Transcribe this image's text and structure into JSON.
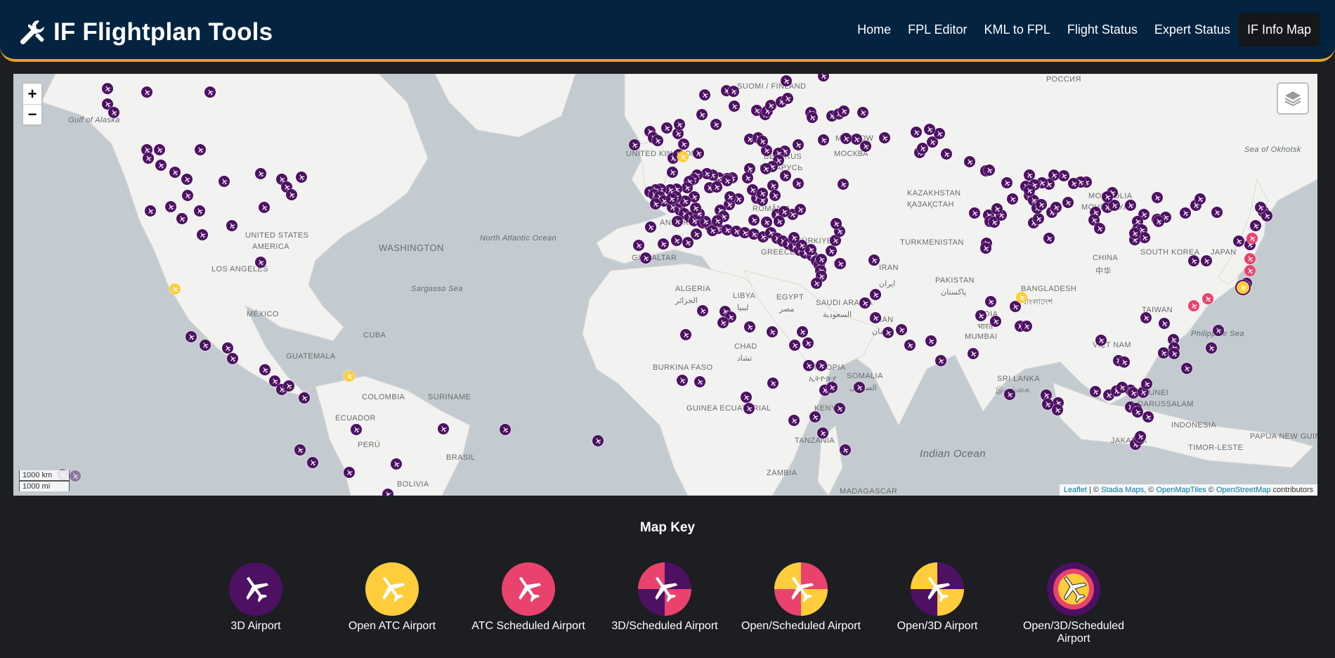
{
  "app": {
    "title": "IF Flightplan Tools",
    "accent_color": "#e6a21f",
    "navbar_color": "#032340",
    "brand_icon": "tools-icon"
  },
  "nav": {
    "items": [
      {
        "label": "Home",
        "active": false
      },
      {
        "label": "FPL Editor",
        "active": false
      },
      {
        "label": "KML to FPL",
        "active": false
      },
      {
        "label": "Flight Status",
        "active": false
      },
      {
        "label": "Expert Status",
        "active": false
      },
      {
        "label": "IF Info Map",
        "active": true
      }
    ]
  },
  "map": {
    "zoom_in": "+",
    "zoom_out": "−",
    "layers_icon": "layers-icon",
    "scale_km": "1000 km",
    "scale_mi": "1000 mi",
    "attribution": {
      "leaflet": "Leaflet",
      "sep1": " | © ",
      "stadia": "Stadia Maps",
      "sep2": ", © ",
      "omt": "OpenMapTiles",
      "sep3": " © ",
      "osm": "OpenStreetMap",
      "tail": " contributors"
    },
    "labels": {
      "russia": "РОССИЯ",
      "finland": "SUOMI / FINLAND",
      "moscow": "MOSCOW",
      "moskva": "МОСКВА",
      "belarus1": "BELARUS",
      "belarus2": "БЕЛАРУСЬ",
      "kazakhstan1": "KAZAKHSTAN",
      "kazakhstan2": "ҚАЗАҚСТАН",
      "mongolia1": "MONGOLIA",
      "mongolia2": "МОНГОЛ УЛС",
      "sea_okhotsk": "Sea of Okhotsk",
      "gulf_alaska": "Gulf of Alaska",
      "united_kingdom": "UNITED KINGDOM",
      "romania": "ROMÂNIA",
      "united_states": "UNITED STATES",
      "america": "AMERICA",
      "washington": "WASHINGTON",
      "los_angeles": "LOS ANGELES",
      "north_atlantic": "North Atlantic Ocean",
      "sargasso": "Sargasso Sea",
      "andorra": "ANDORRA",
      "gibraltar": "GIBRALTAR",
      "algeria1": "ALGERIA",
      "algeria2": "الجزائر",
      "libya1": "LIBYA",
      "libya2": "ليبيا",
      "egypt1": "EGYPT",
      "egypt2": "مصر",
      "saudi1": "SAUDI ARABIA",
      "saudi2": "السعودية",
      "turkmenistan": "TURKMENISTAN",
      "turkiye": "TÜRKIYE",
      "greece": "GREECE",
      "iran1": "IRAN",
      "iran2": "ایران",
      "pakistan1": "PAKISTAN",
      "pakistan2": "پاکستان",
      "india1": "INDIA",
      "india2": "भारत",
      "bangladesh1": "BANGLADESH",
      "bangladesh2": "বাংলাদেশ",
      "china1": "CHINA",
      "china2": "中华",
      "south_korea": "SOUTH KOREA",
      "japan": "JAPAN",
      "taiwan": "TAIWAN",
      "philippine_sea": "Philippine Sea",
      "oman1": "OMAN",
      "oman2": "عمان",
      "mumbai": "MUMBAI",
      "sri_lanka1": "SRI LANKA",
      "sri_lanka2": "இலங்கை",
      "viet_nam": "VIỆT NAM",
      "mexico": "MÉXICO",
      "guatemala": "GUATEMALA",
      "colombia": "COLOMBIA",
      "suriname": "SURINAME",
      "ecuador": "ECUADOR",
      "peru": "PERÚ",
      "brasil": "BRASIL",
      "bolivia": "BOLIVIA",
      "cuba": "CUBA",
      "chad1": "CHAD",
      "chad2": "تشاد",
      "burkina": "BURKINA FASO",
      "guinea": "GUINEA ECUATORIAL",
      "ethiopia1": "ETHIOPIA",
      "ethiopia2": "ኢትዮጵያ",
      "somalia1": "SOMALIA",
      "somalia2": "الصومال",
      "kenya": "KENYA",
      "tanzania": "TANZANIA",
      "zambia": "ZAMBIA",
      "madagascar": "MADAGASCAR",
      "indian_ocean": "Indian Ocean",
      "indonesia": "INDONESIA",
      "papua": "PAPUA NEW GUINEA",
      "timor": "TIMOR-LESTE",
      "jakarta": "JAKARTA",
      "brunei": "BRUNEI",
      "darussalam": "DARUSSALAM",
      "mongolia_c": "MONGOLIA"
    },
    "colors": {
      "water": "#c3cbd0",
      "land": "#f2f2f0",
      "marker_3d": "#4d1063",
      "marker_atc": "#ffcd3c",
      "marker_sched": "#e9426d"
    }
  },
  "key": {
    "title": "Map Key",
    "items": [
      {
        "label": "3D Airport",
        "icon": "3d-airport-icon",
        "colors": [
          "#4d1063"
        ]
      },
      {
        "label": "Open ATC Airport",
        "icon": "open-atc-airport-icon",
        "colors": [
          "#ffcd3c"
        ]
      },
      {
        "label": "ATC Scheduled Airport",
        "icon": "atc-scheduled-airport-icon",
        "colors": [
          "#e9426d"
        ]
      },
      {
        "label": "3D/Scheduled Airport",
        "icon": "3d-scheduled-airport-icon",
        "colors": [
          "#4d1063",
          "#e9426d"
        ]
      },
      {
        "label": "Open/Scheduled Airport",
        "icon": "open-scheduled-airport-icon",
        "colors": [
          "#ffcd3c",
          "#e9426d"
        ]
      },
      {
        "label": "Open/3D Airport",
        "icon": "open-3d-airport-icon",
        "colors": [
          "#ffcd3c",
          "#4d1063"
        ]
      },
      {
        "label": "Open/3D/Scheduled Airport",
        "icon": "open-3d-scheduled-airport-icon",
        "colors": [
          "#4d1063",
          "#e9426d",
          "#ffcd3c"
        ]
      }
    ]
  }
}
